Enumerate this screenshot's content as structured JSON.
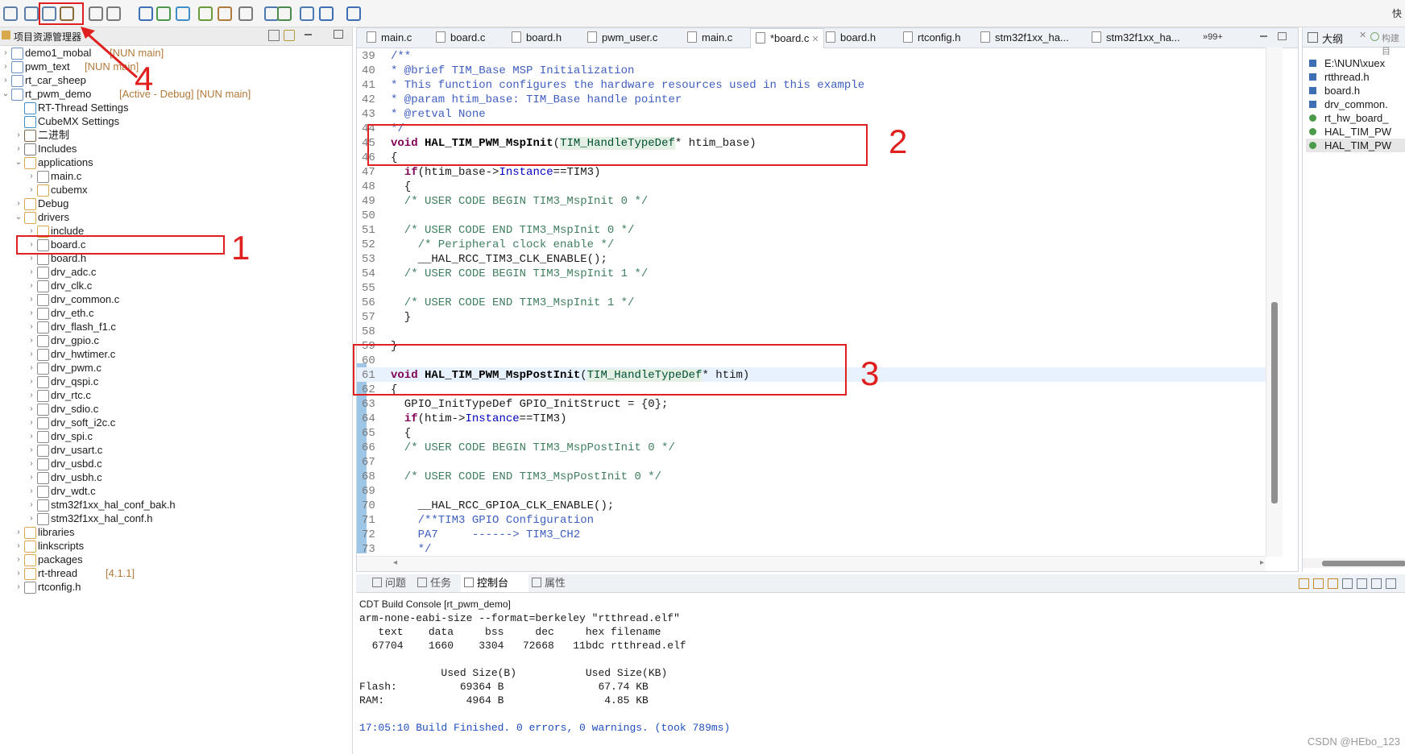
{
  "toolbar": {
    "corner_label": "快"
  },
  "project_explorer": {
    "title": "项目资源管理器",
    "items": [
      {
        "label": "demo1_mobal",
        "decoration": "[NUN main]"
      },
      {
        "label": "pwm_text",
        "decoration": "[NUN main]"
      },
      {
        "label": "rt_car_sheep",
        "decoration": ""
      },
      {
        "label": "rt_pwm_demo",
        "decoration": "[Active - Debug] [NUN main]"
      },
      {
        "label": "RT-Thread Settings",
        "decoration": ""
      },
      {
        "label": "CubeMX Settings",
        "decoration": ""
      },
      {
        "label": "二进制",
        "decoration": ""
      },
      {
        "label": "Includes",
        "decoration": ""
      },
      {
        "label": "applications",
        "decoration": ""
      },
      {
        "label": "main.c",
        "decoration": ""
      },
      {
        "label": "cubemx",
        "decoration": ""
      },
      {
        "label": "Debug",
        "decoration": ""
      },
      {
        "label": "drivers",
        "decoration": ""
      },
      {
        "label": "include",
        "decoration": ""
      },
      {
        "label": "board.c",
        "decoration": ""
      },
      {
        "label": "board.h",
        "decoration": ""
      },
      {
        "label": "drv_adc.c",
        "decoration": ""
      },
      {
        "label": "drv_clk.c",
        "decoration": ""
      },
      {
        "label": "drv_common.c",
        "decoration": ""
      },
      {
        "label": "drv_eth.c",
        "decoration": ""
      },
      {
        "label": "drv_flash_f1.c",
        "decoration": ""
      },
      {
        "label": "drv_gpio.c",
        "decoration": ""
      },
      {
        "label": "drv_hwtimer.c",
        "decoration": ""
      },
      {
        "label": "drv_pwm.c",
        "decoration": ""
      },
      {
        "label": "drv_qspi.c",
        "decoration": ""
      },
      {
        "label": "drv_rtc.c",
        "decoration": ""
      },
      {
        "label": "drv_sdio.c",
        "decoration": ""
      },
      {
        "label": "drv_soft_i2c.c",
        "decoration": ""
      },
      {
        "label": "drv_spi.c",
        "decoration": ""
      },
      {
        "label": "drv_usart.c",
        "decoration": ""
      },
      {
        "label": "drv_usbd.c",
        "decoration": ""
      },
      {
        "label": "drv_usbh.c",
        "decoration": ""
      },
      {
        "label": "drv_wdt.c",
        "decoration": ""
      },
      {
        "label": "stm32f1xx_hal_conf_bak.h",
        "decoration": ""
      },
      {
        "label": "stm32f1xx_hal_conf.h",
        "decoration": ""
      },
      {
        "label": "libraries",
        "decoration": ""
      },
      {
        "label": "linkscripts",
        "decoration": ""
      },
      {
        "label": "packages",
        "decoration": ""
      },
      {
        "label": "rt-thread",
        "decoration": "[4.1.1]"
      },
      {
        "label": "rtconfig.h",
        "decoration": ""
      }
    ]
  },
  "editor": {
    "tabs": [
      {
        "label": "main.c"
      },
      {
        "label": "board.c"
      },
      {
        "label": "board.h"
      },
      {
        "label": "pwm_user.c"
      },
      {
        "label": "main.c"
      },
      {
        "label": "*board.c"
      },
      {
        "label": "board.h"
      },
      {
        "label": "rtconfig.h"
      },
      {
        "label": "stm32f1xx_ha..."
      },
      {
        "label": "stm32f1xx_ha..."
      }
    ],
    "tab_overflow": "»99+",
    "lines": [
      {
        "num": "39",
        "parts": [
          {
            "c": "cmb",
            "t": "/**"
          }
        ]
      },
      {
        "num": "40",
        "parts": [
          {
            "c": "cmb",
            "t": "* @brief TIM_Base MSP Initialization"
          }
        ]
      },
      {
        "num": "41",
        "parts": [
          {
            "c": "cmb",
            "t": "* This function configures the hardware resources used in this example"
          }
        ]
      },
      {
        "num": "42",
        "parts": [
          {
            "c": "cmb",
            "t": "* @param htim_base: TIM_Base handle pointer"
          }
        ]
      },
      {
        "num": "43",
        "parts": [
          {
            "c": "cmb",
            "t": "* @retval None"
          }
        ]
      },
      {
        "num": "44",
        "parts": [
          {
            "c": "cmb",
            "t": "*/"
          }
        ]
      },
      {
        "num": "45",
        "parts": [
          {
            "c": "kw",
            "t": "void "
          },
          {
            "c": "fn",
            "t": "HAL_TIM_PWM_MspInit"
          },
          {
            "c": "",
            "t": "("
          },
          {
            "c": "ty",
            "t": "TIM_HandleTypeDef"
          },
          {
            "c": "",
            "t": "* htim_base)"
          }
        ]
      },
      {
        "num": "46",
        "parts": [
          {
            "c": "",
            "t": "{"
          }
        ]
      },
      {
        "num": "47",
        "parts": [
          {
            "c": "",
            "t": "  "
          },
          {
            "c": "kw",
            "t": "if"
          },
          {
            "c": "",
            "t": "(htim_base->"
          },
          {
            "c": "fld",
            "t": "Instance"
          },
          {
            "c": "",
            "t": "==TIM3)"
          }
        ]
      },
      {
        "num": "48",
        "parts": [
          {
            "c": "",
            "t": "  {"
          }
        ]
      },
      {
        "num": "49",
        "parts": [
          {
            "c": "cm",
            "t": "  /* USER CODE BEGIN TIM3_MspInit 0 */"
          }
        ]
      },
      {
        "num": "50",
        "parts": [
          {
            "c": "",
            "t": ""
          }
        ]
      },
      {
        "num": "51",
        "parts": [
          {
            "c": "cm",
            "t": "  /* USER CODE END TIM3_MspInit 0 */"
          }
        ]
      },
      {
        "num": "52",
        "parts": [
          {
            "c": "cm",
            "t": "    /* Peripheral clock enable */"
          }
        ]
      },
      {
        "num": "53",
        "parts": [
          {
            "c": "",
            "t": "    __HAL_RCC_TIM3_CLK_ENABLE();"
          }
        ]
      },
      {
        "num": "54",
        "parts": [
          {
            "c": "cm",
            "t": "  /* USER CODE BEGIN TIM3_MspInit 1 */"
          }
        ]
      },
      {
        "num": "55",
        "parts": [
          {
            "c": "",
            "t": ""
          }
        ]
      },
      {
        "num": "56",
        "parts": [
          {
            "c": "cm",
            "t": "  /* USER CODE END TIM3_MspInit 1 */"
          }
        ]
      },
      {
        "num": "57",
        "parts": [
          {
            "c": "",
            "t": "  }"
          }
        ]
      },
      {
        "num": "58",
        "parts": [
          {
            "c": "",
            "t": ""
          }
        ]
      },
      {
        "num": "59",
        "parts": [
          {
            "c": "",
            "t": "}"
          }
        ]
      },
      {
        "num": "60",
        "parts": [
          {
            "c": "",
            "t": ""
          }
        ]
      },
      {
        "num": "61",
        "parts": [
          {
            "c": "kw",
            "t": "void "
          },
          {
            "c": "fn",
            "t": "HAL_TIM_PWM_MspPostInit"
          },
          {
            "c": "",
            "t": "("
          },
          {
            "c": "ty",
            "t": "TIM_HandleTypeDef"
          },
          {
            "c": "",
            "t": "* htim)"
          }
        ]
      },
      {
        "num": "62",
        "parts": [
          {
            "c": "",
            "t": "{"
          }
        ]
      },
      {
        "num": "63",
        "parts": [
          {
            "c": "",
            "t": "  GPIO_InitTypeDef GPIO_InitStruct = {0};"
          }
        ]
      },
      {
        "num": "64",
        "parts": [
          {
            "c": "",
            "t": "  "
          },
          {
            "c": "kw",
            "t": "if"
          },
          {
            "c": "",
            "t": "(htim->"
          },
          {
            "c": "fld",
            "t": "Instance"
          },
          {
            "c": "",
            "t": "==TIM3)"
          }
        ]
      },
      {
        "num": "65",
        "parts": [
          {
            "c": "",
            "t": "  {"
          }
        ]
      },
      {
        "num": "66",
        "parts": [
          {
            "c": "cm",
            "t": "  /* USER CODE BEGIN TIM3_MspPostInit 0 */"
          }
        ]
      },
      {
        "num": "67",
        "parts": [
          {
            "c": "",
            "t": ""
          }
        ]
      },
      {
        "num": "68",
        "parts": [
          {
            "c": "cm",
            "t": "  /* USER CODE END TIM3_MspPostInit 0 */"
          }
        ]
      },
      {
        "num": "69",
        "parts": [
          {
            "c": "",
            "t": ""
          }
        ]
      },
      {
        "num": "70",
        "parts": [
          {
            "c": "",
            "t": "    __HAL_RCC_GPIOA_CLK_ENABLE();"
          }
        ]
      },
      {
        "num": "71",
        "parts": [
          {
            "c": "cmb",
            "t": "    /**TIM3 GPIO Configuration"
          }
        ]
      },
      {
        "num": "72",
        "parts": [
          {
            "c": "cmb",
            "t": "    PA7     ------> TIM3_CH2"
          }
        ]
      },
      {
        "num": "73",
        "parts": [
          {
            "c": "cmb",
            "t": "    */"
          }
        ]
      }
    ]
  },
  "outline": {
    "title": "大纲",
    "tab2": "构建目",
    "items": [
      {
        "label": "E:\\NUN\\xuex"
      },
      {
        "label": "rtthread.h"
      },
      {
        "label": "board.h"
      },
      {
        "label": "drv_common."
      },
      {
        "label": "rt_hw_board_"
      },
      {
        "label": "HAL_TIM_PW"
      },
      {
        "label": "HAL_TIM_PW"
      }
    ]
  },
  "console": {
    "tabs": [
      {
        "label": "问题"
      },
      {
        "label": "任务"
      },
      {
        "label": "控制台"
      },
      {
        "label": "属性"
      }
    ],
    "title": "CDT Build Console [rt_pwm_demo]",
    "lines": [
      "arm-none-eabi-size --format=berkeley \"rtthread.elf\"",
      "   text    data     bss     dec     hex filename",
      "  67704    1660    3304   72668   11bdc rtthread.elf",
      "",
      "             Used Size(B)           Used Size(KB)",
      "Flash:          69364 B               67.74 KB",
      "RAM:             4964 B                4.85 KB",
      "",
      "17:05:10 Build Finished. 0 errors, 0 warnings. (took 789ms)"
    ]
  },
  "annotations": {
    "n1": "1",
    "n2": "2",
    "n3": "3",
    "n4": "4"
  },
  "watermark": "CSDN @HEbo_123"
}
